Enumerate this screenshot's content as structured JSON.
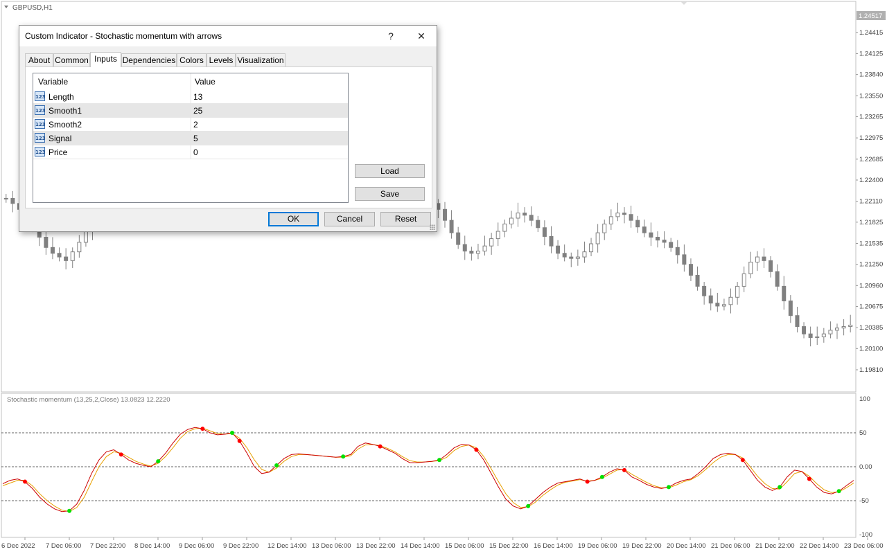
{
  "chart": {
    "symbol_label": "GBPUSD,H1",
    "current_price": "1.24517",
    "price_ticks": [
      "1.24415",
      "1.24125",
      "1.23840",
      "1.23550",
      "1.23265",
      "1.22975",
      "1.22685",
      "1.22400",
      "1.22110",
      "1.21825",
      "1.21535",
      "1.21250",
      "1.20960",
      "1.20675",
      "1.20385",
      "1.20100",
      "1.19810"
    ],
    "price_range": [
      1.1981,
      1.24517
    ],
    "indicator_label": "Stochastic momentum (13,25,2,Close) 13.0823 12.2220",
    "indicator_ticks": [
      "100",
      "50",
      "0.00",
      "-50",
      "-100"
    ],
    "indicator_levels": [
      50,
      0,
      -50
    ],
    "time_labels": [
      "6 Dec 2022",
      "7 Dec 06:00",
      "7 Dec 22:00",
      "8 Dec 14:00",
      "9 Dec 06:00",
      "9 Dec 22:00",
      "12 Dec 14:00",
      "13 Dec 06:00",
      "13 Dec 22:00",
      "14 Dec 14:00",
      "15 Dec 06:00",
      "15 Dec 22:00",
      "16 Dec 14:00",
      "19 Dec 06:00",
      "19 Dec 22:00",
      "20 Dec 14:00",
      "21 Dec 06:00",
      "21 Dec 22:00",
      "22 Dec 14:00",
      "23 Dec 06:00"
    ],
    "colors": {
      "candle": "#808080",
      "bg": "#ffffff",
      "smi_line": "#cc0000",
      "signal_line": "#e8a000",
      "arrow_down": "#ff0000",
      "arrow_up": "#00e000",
      "level": "#333333"
    }
  },
  "dialog": {
    "title": "Custom Indicator - Stochastic momentum with arrows",
    "help_label": "?",
    "close_label": "✕",
    "tabs": [
      {
        "label": "About"
      },
      {
        "label": "Common"
      },
      {
        "label": "Inputs",
        "active": true
      },
      {
        "label": "Dependencies"
      },
      {
        "label": "Colors"
      },
      {
        "label": "Levels"
      },
      {
        "label": "Visualization"
      }
    ],
    "grid": {
      "headers": {
        "variable": "Variable",
        "value": "Value"
      },
      "icon_text": "123",
      "rows": [
        {
          "variable": "Length",
          "value": "13"
        },
        {
          "variable": "Smooth1",
          "value": "25"
        },
        {
          "variable": "Smooth2",
          "value": "2"
        },
        {
          "variable": "Signal",
          "value": "5"
        },
        {
          "variable": "Price",
          "value": "0"
        }
      ]
    },
    "buttons": {
      "load": "Load",
      "save": "Save",
      "ok": "OK",
      "cancel": "Cancel",
      "reset": "Reset"
    }
  },
  "chart_data": [
    {
      "type": "candlestick",
      "title": "GBPUSD,H1",
      "ylim": [
        1.1981,
        1.24517
      ],
      "close_series": [
        1.2215,
        1.2208,
        1.22,
        1.219,
        1.2175,
        1.2162,
        1.2148,
        1.214,
        1.2135,
        1.213,
        1.2142,
        1.2155,
        1.217,
        1.2186,
        1.22,
        1.2215,
        1.2232,
        1.2248,
        1.2262,
        1.227,
        1.2262,
        1.225,
        1.224,
        1.2228,
        1.222,
        1.2212,
        1.2206,
        1.22,
        1.2196,
        1.2193,
        1.2196,
        1.2205,
        1.2225,
        1.225,
        1.228,
        1.231,
        1.234,
        1.2372,
        1.24,
        1.242,
        1.243,
        1.2435,
        1.2436,
        1.2432,
        1.2425,
        1.2415,
        1.2405,
        1.2395,
        1.2385,
        1.237,
        1.235,
        1.232,
        1.229,
        1.226,
        1.2235,
        1.2215,
        1.22,
        1.219,
        1.2186,
        1.219,
        1.2198,
        1.2205,
        1.221,
        1.2212,
        1.2208,
        1.22,
        1.2185,
        1.2168,
        1.2152,
        1.2143,
        1.214,
        1.2143,
        1.215,
        1.216,
        1.217,
        1.218,
        1.2188,
        1.2195,
        1.2192,
        1.2185,
        1.2175,
        1.2163,
        1.215,
        1.214,
        1.2135,
        1.2133,
        1.2135,
        1.2142,
        1.2153,
        1.2168,
        1.218,
        1.219,
        1.2195,
        1.2193,
        1.2185,
        1.2176,
        1.2168,
        1.2162,
        1.2158,
        1.2155,
        1.2148,
        1.2138,
        1.2125,
        1.211,
        1.2095,
        1.2082,
        1.2072,
        1.2068,
        1.207,
        1.208,
        1.2095,
        1.2112,
        1.2128,
        1.2135,
        1.213,
        1.2115,
        1.2095,
        1.2075,
        1.2055,
        1.204,
        1.203,
        1.2025,
        1.2026,
        1.203,
        1.2035,
        1.2038,
        1.204,
        1.2042
      ]
    },
    {
      "type": "line",
      "title": "Stochastic momentum (13,25,2,Close) 13.0823 12.2220",
      "ylim": [
        -100,
        100
      ],
      "levels": [
        50,
        0,
        -50
      ],
      "series": [
        {
          "values": [
            -25,
            -20,
            -18,
            -22,
            -32,
            -45,
            -55,
            -62,
            -66,
            -65,
            -55,
            -35,
            -10,
            10,
            22,
            25,
            18,
            10,
            5,
            2,
            0,
            8,
            20,
            35,
            48,
            55,
            58,
            56,
            50,
            47,
            48,
            50,
            38,
            20,
            0,
            -10,
            -8,
            2,
            12,
            18,
            19,
            18,
            17,
            16,
            15,
            14,
            15,
            18,
            30,
            35,
            33,
            30,
            25,
            20,
            12,
            6,
            6,
            7,
            8,
            10,
            18,
            28,
            33,
            32,
            25,
            10,
            -10,
            -30,
            -48,
            -58,
            -62,
            -58,
            -48,
            -38,
            -30,
            -24,
            -22,
            -20,
            -18,
            -22,
            -20,
            -15,
            -8,
            -3,
            -5,
            -15,
            -20,
            -26,
            -30,
            -32,
            -30,
            -24,
            -20,
            -18,
            -10,
            0,
            12,
            18,
            20,
            18,
            10,
            -5,
            -20,
            -30,
            -35,
            -30,
            -15,
            -5,
            -7,
            -18,
            -30,
            -38,
            -40,
            -36,
            -28,
            -20
          ]
        },
        {
          "values": [
            -28,
            -24,
            -20,
            -20,
            -28,
            -40,
            -50,
            -58,
            -64,
            -66,
            -60,
            -45,
            -22,
            0,
            15,
            22,
            20,
            14,
            8,
            4,
            1,
            5,
            15,
            28,
            42,
            52,
            56,
            57,
            53,
            49,
            48,
            49,
            42,
            28,
            10,
            -4,
            -8,
            -2,
            8,
            15,
            18,
            18,
            17,
            16,
            15,
            14,
            14,
            16,
            26,
            32,
            33,
            31,
            27,
            22,
            15,
            9,
            7,
            7,
            8,
            9,
            14,
            24,
            30,
            32,
            28,
            15,
            -3,
            -22,
            -40,
            -53,
            -60,
            -59,
            -52,
            -42,
            -34,
            -27,
            -23,
            -21,
            -19,
            -21,
            -20,
            -17,
            -11,
            -5,
            -4,
            -11,
            -17,
            -23,
            -28,
            -31,
            -31,
            -27,
            -22,
            -19,
            -13,
            -4,
            6,
            14,
            18,
            18,
            13,
            0,
            -14,
            -25,
            -32,
            -33,
            -22,
            -10,
            -7,
            -14,
            -25,
            -34,
            -38,
            -37,
            -31,
            -24
          ]
        }
      ]
    }
  ]
}
